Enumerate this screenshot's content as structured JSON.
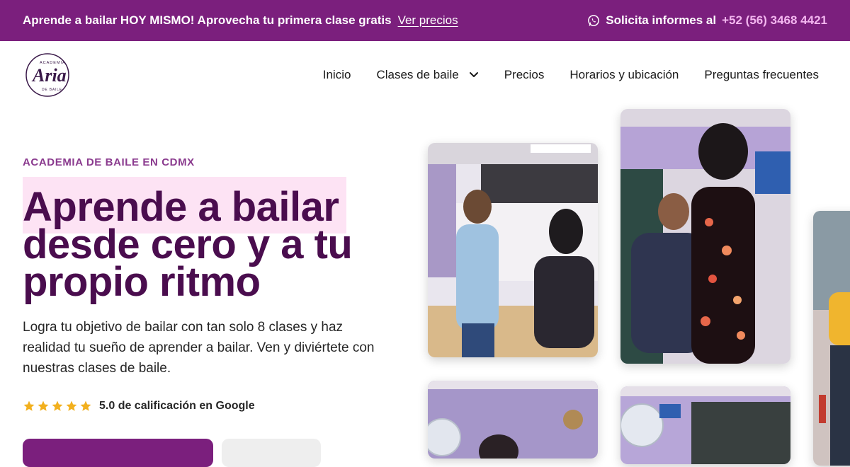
{
  "topbar": {
    "promo_text": "Aprende a bailar HOY MISMO! Aprovecha tu primera clase gratis",
    "promo_link": "Ver precios",
    "contact_text": "Solicita informes al",
    "phone": "+52 (56) 3468 4421",
    "background": "#7b1f7d"
  },
  "logo": {
    "top": "ACADEMIA",
    "main": "Aria",
    "bottom": "DE BAILE"
  },
  "nav": {
    "items": [
      {
        "label": "Inicio"
      },
      {
        "label": "Clases de baile",
        "has_dropdown": true
      },
      {
        "label": "Precios"
      },
      {
        "label": "Horarios y ubicación"
      },
      {
        "label": "Preguntas frecuentes"
      }
    ]
  },
  "hero": {
    "eyebrow": "ACADEMIA DE BAILE EN CDMX",
    "headline_line1": "Aprende a bailar",
    "headline_line2": "desde cero y a tu",
    "headline_line3": "propio ritmo",
    "subtext": "Logra tu objetivo de bailar con tan solo 8 clases y haz realidad tu sueño de aprender a bailar. Ven y diviértete con nuestras clases de baile.",
    "rating_stars": 5,
    "rating_text": "5.0 de calificación en Google",
    "accent_color": "#4a0d4e",
    "star_color": "#f2b01e"
  },
  "gallery": {
    "photos": [
      {
        "subject": "dance-class-couple"
      },
      {
        "subject": "dance-class-spin"
      },
      {
        "subject": "dance-class-group"
      },
      {
        "subject": "dance-studio-fan"
      },
      {
        "subject": "dance-student-yellow"
      }
    ]
  }
}
